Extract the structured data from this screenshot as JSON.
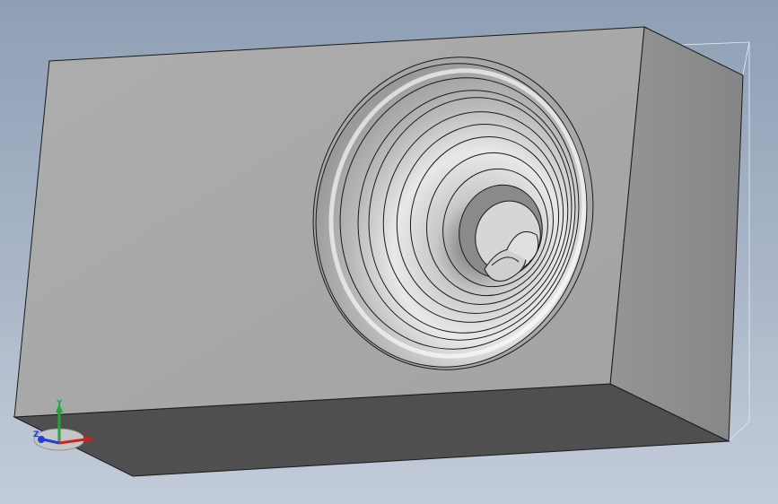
{
  "viewport": {
    "background_top": "#8e9fb5",
    "background_bottom": "#c3ccd9"
  },
  "part": {
    "front_face_color": "#a9a9a9",
    "right_face_color": "#8c8c8c",
    "bottom_face_color": "#4f4f4f",
    "edge_color": "#1a1a1a",
    "highlight_color": "#ffffff"
  },
  "triad": {
    "x_label": "X",
    "y_label": "Y",
    "z_label": "Z",
    "x_color": "#d21f1f",
    "y_color": "#22a63a",
    "z_color": "#1f3fcc"
  }
}
